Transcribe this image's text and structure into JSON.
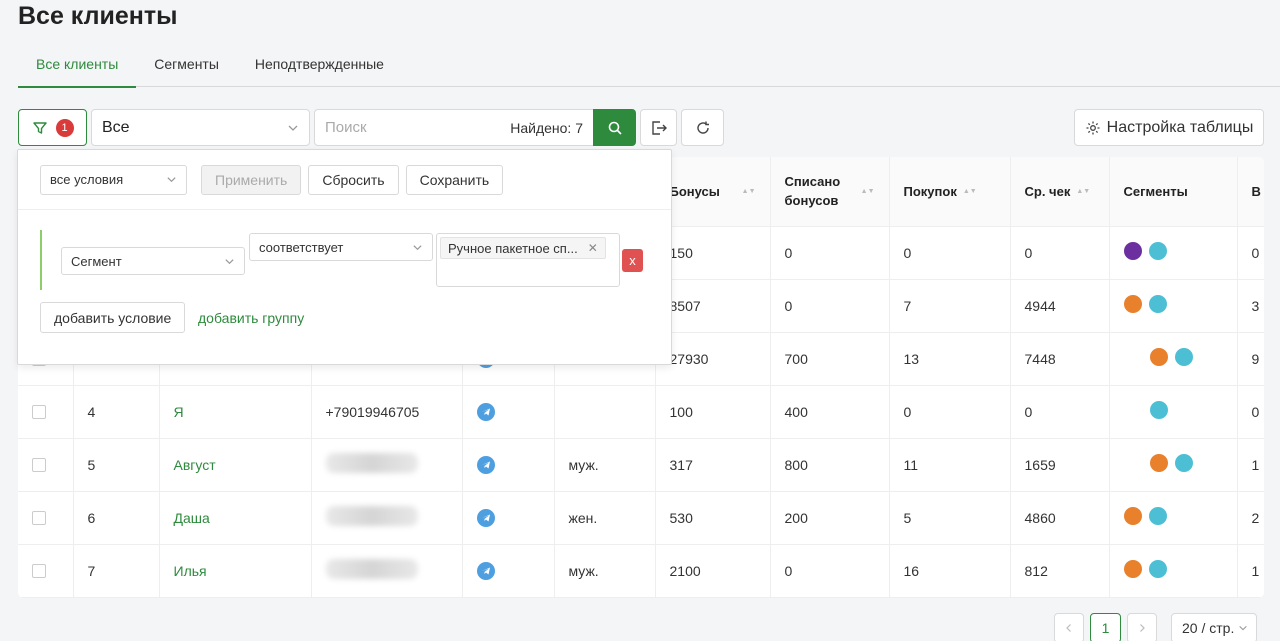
{
  "page": {
    "title": "Все клиенты"
  },
  "tabs": [
    {
      "label": "Все клиенты",
      "active": true
    },
    {
      "label": "Сегменты",
      "active": false
    },
    {
      "label": "Неподтвержденные",
      "active": false
    }
  ],
  "toolbar": {
    "filter_badge": "1",
    "segment_select_value": "Все",
    "search_placeholder": "Поиск",
    "found_text": "Найдено: 7",
    "settings_label": "Настройка таблицы"
  },
  "filter_panel": {
    "conditions_mode": "все условия",
    "apply_label": "Применить",
    "reset_label": "Сбросить",
    "save_label": "Сохранить",
    "field": "Сегмент",
    "operator": "соответствует",
    "value_tag": "Ручное пакетное сп...",
    "delete_label": "x",
    "add_condition_label": "добавить условие",
    "add_group_label": "добавить группу"
  },
  "table": {
    "columns": [
      "Бонусы",
      "Списано бонусов",
      "Покупок",
      "Ср. чек",
      "Сегменты",
      "В"
    ],
    "rows": [
      {
        "num": "",
        "name": "",
        "phone": "",
        "channel": false,
        "gender": "",
        "bonus": "150",
        "spent": "0",
        "purchases": "0",
        "avg": "0",
        "segments": [
          "#6b2fa0",
          "#4dbfd4"
        ],
        "seg_offset": false,
        "last": "0"
      },
      {
        "num": "",
        "name": "",
        "phone": "",
        "channel": false,
        "gender": "",
        "bonus": "8507",
        "spent": "0",
        "purchases": "7",
        "avg": "4944",
        "segments": [
          "#e8802c",
          "#4dbfd4"
        ],
        "seg_offset": false,
        "last": "3"
      },
      {
        "num": "",
        "name": "",
        "phone": "",
        "channel": true,
        "gender": "",
        "bonus": "27930",
        "spent": "700",
        "purchases": "13",
        "avg": "7448",
        "segments": [
          "#e8802c",
          "#4dbfd4"
        ],
        "seg_offset": true,
        "last": "9"
      },
      {
        "num": "4",
        "name": "Я",
        "phone": "+79019946705",
        "channel": true,
        "gender": "",
        "bonus": "100",
        "spent": "400",
        "purchases": "0",
        "avg": "0",
        "segments": [
          "#4dbfd4"
        ],
        "seg_offset": true,
        "last": "0"
      },
      {
        "num": "5",
        "name": "Август",
        "phone": "blur",
        "channel": true,
        "gender": "муж.",
        "bonus": "317",
        "spent": "800",
        "purchases": "11",
        "avg": "1659",
        "segments": [
          "#e8802c",
          "#4dbfd4"
        ],
        "seg_offset": true,
        "last": "1"
      },
      {
        "num": "6",
        "name": "Даша",
        "phone": "blur",
        "channel": true,
        "gender": "жен.",
        "bonus": "530",
        "spent": "200",
        "purchases": "5",
        "avg": "4860",
        "segments": [
          "#e8802c",
          "#4dbfd4"
        ],
        "seg_offset": false,
        "last": "2"
      },
      {
        "num": "7",
        "name": "Илья",
        "phone": "blur",
        "channel": true,
        "gender": "муж.",
        "bonus": "2100",
        "spent": "0",
        "purchases": "16",
        "avg": "812",
        "segments": [
          "#e8802c",
          "#4dbfd4"
        ],
        "seg_offset": false,
        "last": "1"
      }
    ]
  },
  "pagination": {
    "current": "1",
    "page_size": "20 / стр."
  },
  "colors": {
    "accent": "#2e8b3d",
    "danger": "#e05151",
    "telegram": "#4e9fe0"
  }
}
